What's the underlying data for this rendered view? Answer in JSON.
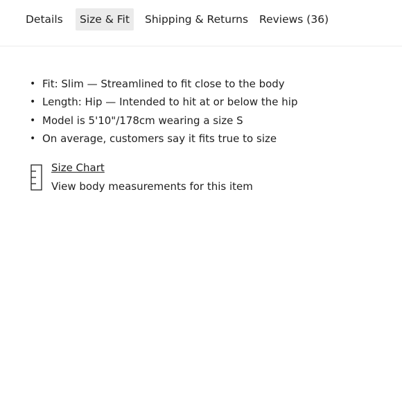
{
  "tabs": [
    {
      "label": "Details",
      "active": false
    },
    {
      "label": "Size & Fit",
      "active": true
    },
    {
      "label": "Shipping & Returns",
      "active": false
    },
    {
      "label": "Reviews (36)",
      "active": false
    }
  ],
  "fit_details": [
    "Fit: Slim — Streamlined to fit close to the body",
    "Length: Hip — Intended to hit at or below the hip",
    "Model is 5'10\"/178cm wearing a size S",
    "On average, customers say it fits true to size"
  ],
  "size_chart": {
    "icon": "ruler-icon",
    "link_label": "Size Chart",
    "description": "View body measurements for this item"
  },
  "colors": {
    "active_tab_bg": "#ebebeb",
    "text": "#1f1f1f",
    "divider": "#ececec"
  }
}
